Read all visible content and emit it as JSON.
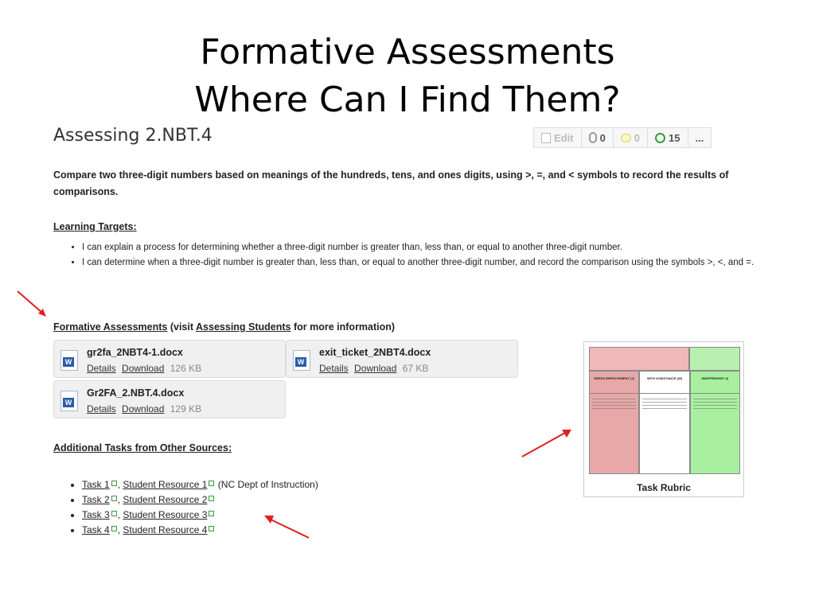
{
  "slide": {
    "title_line1": "Formative Assessments",
    "title_line2": "Where Can I Find Them?"
  },
  "page": {
    "heading": "Assessing 2.NBT.4",
    "description": "Compare two three-digit numbers based on meanings of the hundreds, tens, and ones digits, using >, =, and < symbols to record the results of comparisons."
  },
  "toolbar": {
    "edit_label": "Edit",
    "attachments_count": "0",
    "comments_count": "0",
    "history_count": "15",
    "more_label": "..."
  },
  "learning_targets": {
    "heading": "Learning Targets:",
    "items": [
      "I can explain a process for determining whether a three-digit number is greater than, less than, or equal to another three-digit number.",
      "I can determine when a three-digit number is greater than, less than, or equal to another three-digit number, and record the comparison using the symbols >, <, and =."
    ]
  },
  "formative": {
    "heading_link": "Formative Assessments",
    "heading_mid": " (visit ",
    "assessing_link": "Assessing Students",
    "heading_end": " for more information)",
    "files": [
      {
        "name": "gr2fa_2NBT4-1.docx",
        "details": "Details",
        "download": "Download",
        "size": "126 KB"
      },
      {
        "name": "exit_ticket_2NBT4.docx",
        "details": "Details",
        "download": "Download",
        "size": "67 KB"
      },
      {
        "name": "Gr2FA_2.NBT.4.docx",
        "details": "Details",
        "download": "Download",
        "size": "129 KB"
      }
    ]
  },
  "additional": {
    "heading": "Additional Tasks from Other Sources:",
    "tasks": [
      {
        "task": "Task 1",
        "resource": "Student Resource 1",
        "note": "(NC Dept of Instruction)"
      },
      {
        "task": "Task 2",
        "resource": "Student Resource 2"
      },
      {
        "task": "Task 3",
        "resource": "Student Resource 3"
      },
      {
        "task": "Task 4",
        "resource": "Student Resource 4"
      }
    ]
  },
  "rubric": {
    "label": "Task Rubric",
    "columns": [
      "NEEDS IMPROVEMENT (1)",
      "WITH ASSISTANCE (W)",
      "INDEPENDENT (I)"
    ]
  },
  "colors": {
    "arrow": "#e02020",
    "rubric_red": "#e8a8a8",
    "rubric_green": "#a8f0a0"
  }
}
